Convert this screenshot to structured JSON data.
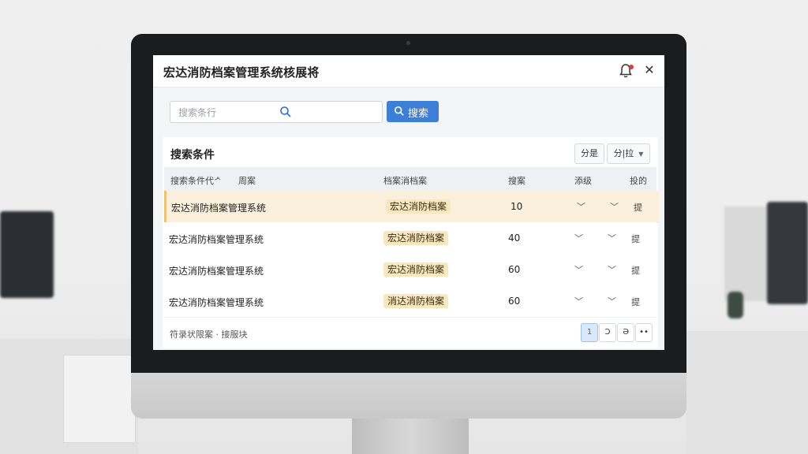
{
  "window": {
    "title": "宏达消防档案管理系统核展将"
  },
  "search": {
    "placeholder": "搜索条行",
    "button_label": "搜索"
  },
  "panel": {
    "title": "搜索条件",
    "button1_label": "分是",
    "button2_label": "分|拉"
  },
  "table": {
    "headers": [
      "搜索条件代ᄼ",
      "周案",
      "档案消档案",
      "搜案",
      "添级",
      "投的"
    ],
    "rows": [
      {
        "name": "宏达消防档案管理系统",
        "tag": "宏达消防档案",
        "value": "10",
        "action": "提",
        "selected": true
      },
      {
        "name": "宏达消防档案管理系统",
        "tag": "宏达消防档案",
        "value": "40",
        "action": "提",
        "selected": false
      },
      {
        "name": "宏达消防档案管理系统",
        "tag": "宏达消防档案",
        "value": "60",
        "action": "提",
        "selected": false
      },
      {
        "name": "宏达消防档案管理系统",
        "tag": "消达消防档案",
        "value": "60",
        "action": "提",
        "selected": false
      }
    ]
  },
  "footer": {
    "text": "符录状限案 · 接服块",
    "pages": [
      "1",
      "Ͻ",
      "Ә",
      "••"
    ]
  },
  "colors": {
    "primary": "#3d7fd6",
    "tag_bg": "#f9e7bf",
    "selected_row": "#fbf0dc",
    "notification": "#e53935"
  }
}
